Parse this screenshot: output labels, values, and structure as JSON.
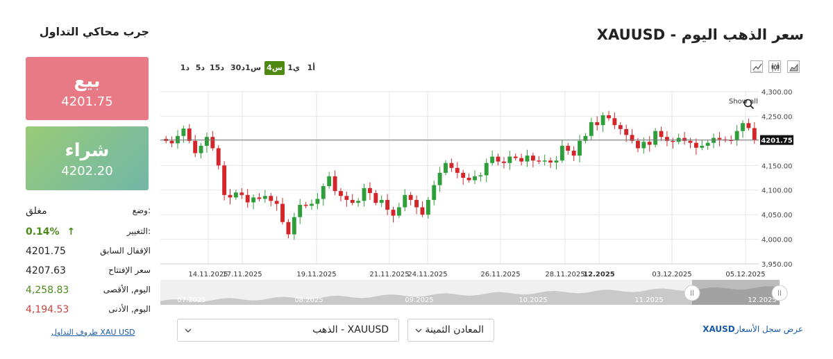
{
  "left": {
    "title": "جرب محاكي التداول",
    "sell": {
      "label": "بيع",
      "price": "4201.75"
    },
    "buy": {
      "label": "شراء",
      "price": "4202.20"
    },
    "stats": {
      "status_label": "وضع:",
      "status_value": "مغلق",
      "change_label": "التغيير:",
      "change_value": "0.14%",
      "change_arrow": "↑",
      "prev_close_label": "الإقفال السابق",
      "prev_close_value": "4201.75",
      "open_label": "سعر الإفتتاح",
      "open_value": "4207.63",
      "high_label": "اليوم, الأقصى",
      "high_value": "4,258.83",
      "low_label": "اليوم, الأدنى",
      "low_value": "4,194.53"
    },
    "terms_link": "XAU USD ظروف التداول"
  },
  "main": {
    "title": "سعر الذهب اليوم - XAUUSD",
    "ranges": [
      {
        "label": "أ1",
        "active": false
      },
      {
        "label": "ي1",
        "active": false
      },
      {
        "label": "س4",
        "active": true
      },
      {
        "label": "س1",
        "active": false
      },
      {
        "label": "د30",
        "active": false
      },
      {
        "label": "د15",
        "active": false
      },
      {
        "label": "د5",
        "active": false
      },
      {
        "label": "د1",
        "active": false
      }
    ],
    "tools": [
      "area-chart-icon",
      "candlestick-chart-icon",
      "line-chart-icon"
    ],
    "show_all": "Show all",
    "symbol_select": "XAUUSD - الذهب",
    "category_select": "المعادن الثمينة",
    "history_link_symbol": "XAUSD",
    "history_link_text": "عرض سجل الأسعار"
  },
  "chart_data": {
    "type": "candlestick",
    "price_axis": {
      "min": 3950,
      "max": 4300,
      "ticks": [
        "4,300.00",
        "4,250.00",
        "4,200.00",
        "4,150.00",
        "4,100.00",
        "4,050.00",
        "4,000.00",
        "3,950.00"
      ]
    },
    "current_price_label": "4201.75",
    "current_price": 4201.75,
    "x_labels": [
      "14.11.2025",
      "17.11.2025",
      "19.11.2025",
      "21.11.2025",
      "24.11.2025",
      "26.11.2025",
      "28.11.2025",
      "12.2025",
      "03.12.2025",
      "05.12.2025"
    ],
    "navigator_labels": [
      "07.2025",
      "08.2025",
      "09.2025",
      "10.2025",
      "11.2025",
      "12.2025"
    ],
    "colors": {
      "up": "#2e9e3a",
      "down": "#d2262a",
      "grid": "#e6e6e6",
      "navigator": "#c9c9c9"
    },
    "closes": [
      4200,
      4195,
      4210,
      4225,
      4200,
      4175,
      4190,
      4208,
      4185,
      4150,
      4090,
      4085,
      4095,
      4090,
      4075,
      4085,
      4082,
      4088,
      4078,
      4072,
      4035,
      4010,
      4045,
      4070,
      4068,
      4072,
      4082,
      4108,
      4128,
      4098,
      4088,
      4080,
      4074,
      4078,
      4104,
      4094,
      4074,
      4080,
      4060,
      4048,
      4065,
      4090,
      4080,
      4065,
      4050,
      4080,
      4110,
      4135,
      4155,
      4145,
      4135,
      4125,
      4120,
      4128,
      4130,
      4155,
      4168,
      4158,
      4155,
      4168,
      4165,
      4158,
      4170,
      4160,
      4158,
      4160,
      4156,
      4160,
      4190,
      4180,
      4170,
      4200,
      4210,
      4238,
      4232,
      4252,
      4246,
      4232,
      4224,
      4212,
      4200,
      4185,
      4198,
      4192,
      4220,
      4208,
      4200,
      4198,
      4206,
      4200,
      4196,
      4186,
      4190,
      4196,
      4206,
      4203,
      4202,
      4201,
      4220,
      4236,
      4226,
      4202
    ]
  }
}
